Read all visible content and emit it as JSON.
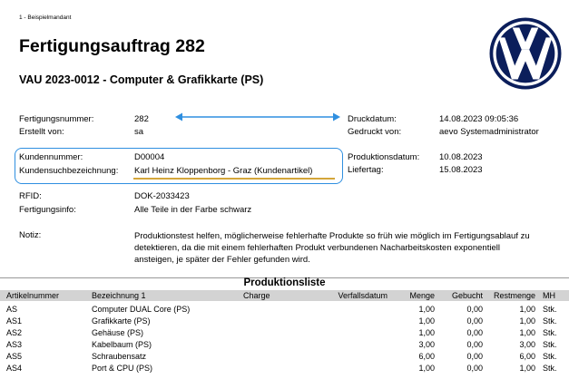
{
  "mandant": "1 - Beispielmandant",
  "title": "Fertigungsauftrag 282",
  "subtitle": "VAU 2023-0012 - Computer & Grafikkarte (PS)",
  "logo": {
    "icon": "vw-logo-icon",
    "color": "#0b1e5b"
  },
  "annotation_color": "#2f8fe0",
  "highlight_color": "#d4a63a",
  "fields": {
    "fertigungsnummer": {
      "label": "Fertigungsnummer:",
      "value": "282"
    },
    "erstellt_von": {
      "label": "Erstellt von:",
      "value": "sa"
    },
    "druckdatum": {
      "label": "Druckdatum:",
      "value": "14.08.2023 09:05:36"
    },
    "gedruckt_von": {
      "label": "Gedruckt von:",
      "value": "aevo Systemadministrator"
    },
    "kundennummer": {
      "label": "Kundennummer:",
      "value": "D00004"
    },
    "kundensuch": {
      "label": "Kundensuchbezeichnung:",
      "value": "Karl Heinz Kloppenborg - Graz (Kundenartikel)"
    },
    "produktionsdatum": {
      "label": "Produktionsdatum:",
      "value": "10.08.2023"
    },
    "liefertag": {
      "label": "Liefertag:",
      "value": "15.08.2023"
    },
    "rfid": {
      "label": "RFID:",
      "value": "DOK-2033423"
    },
    "fertigungsinfo": {
      "label": "Fertigungsinfo:",
      "value": "Alle Teile in der Farbe schwarz"
    },
    "notiz": {
      "label": "Notiz:",
      "value": "Produktionstest helfen, möglicherweise fehlerhafte Produkte so früh wie möglich im Fertigungsablauf zu detektieren, da die mit einem fehlerhaften Produkt verbundenen Nacharbeitskosten exponentiell ansteigen, je später der Fehler gefunden wird."
    }
  },
  "produktionsliste": {
    "title": "Produktionsliste",
    "columns": [
      "Artikelnummer",
      "Bezeichnung 1",
      "Charge",
      "Verfallsdatum",
      "Menge",
      "Gebucht",
      "Restmenge",
      "MH"
    ],
    "rows": [
      [
        "AS",
        "Computer DUAL Core (PS)",
        "",
        "",
        "1,00",
        "0,00",
        "1,00",
        "Stk."
      ],
      [
        "AS1",
        "Grafikkarte (PS)",
        "",
        "",
        "1,00",
        "0,00",
        "1,00",
        "Stk."
      ],
      [
        "AS2",
        "Gehäuse (PS)",
        "",
        "",
        "1,00",
        "0,00",
        "1,00",
        "Stk."
      ],
      [
        "AS3",
        "Kabelbaum (PS)",
        "",
        "",
        "3,00",
        "0,00",
        "3,00",
        "Stk."
      ],
      [
        "AS5",
        "Schraubensatz",
        "",
        "",
        "6,00",
        "0,00",
        "6,00",
        "Stk."
      ],
      [
        "AS4",
        "Port & CPU (PS)",
        "",
        "",
        "1,00",
        "0,00",
        "1,00",
        "Stk."
      ]
    ]
  }
}
